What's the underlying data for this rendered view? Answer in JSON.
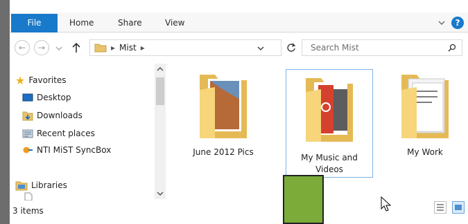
{
  "ribbon": {
    "tabs": [
      "File",
      "Home",
      "Share",
      "View"
    ]
  },
  "address": {
    "path": [
      "Mist"
    ],
    "search_placeholder": "Search Mist"
  },
  "nav": {
    "favorites_label": "Favorites",
    "favorites": [
      "Desktop",
      "Downloads",
      "Recent places",
      "NTI MiST SyncBox"
    ],
    "libraries_label": "Libraries"
  },
  "content": {
    "items": [
      {
        "label": "June 2012 Pics"
      },
      {
        "label": "My Music and Videos"
      },
      {
        "label": "My Work"
      }
    ]
  },
  "status": {
    "count_text": "3 items"
  },
  "colors": {
    "accent": "#1979ca",
    "selection_border": "#7eb4ea",
    "green_box": "#7cab3a"
  }
}
